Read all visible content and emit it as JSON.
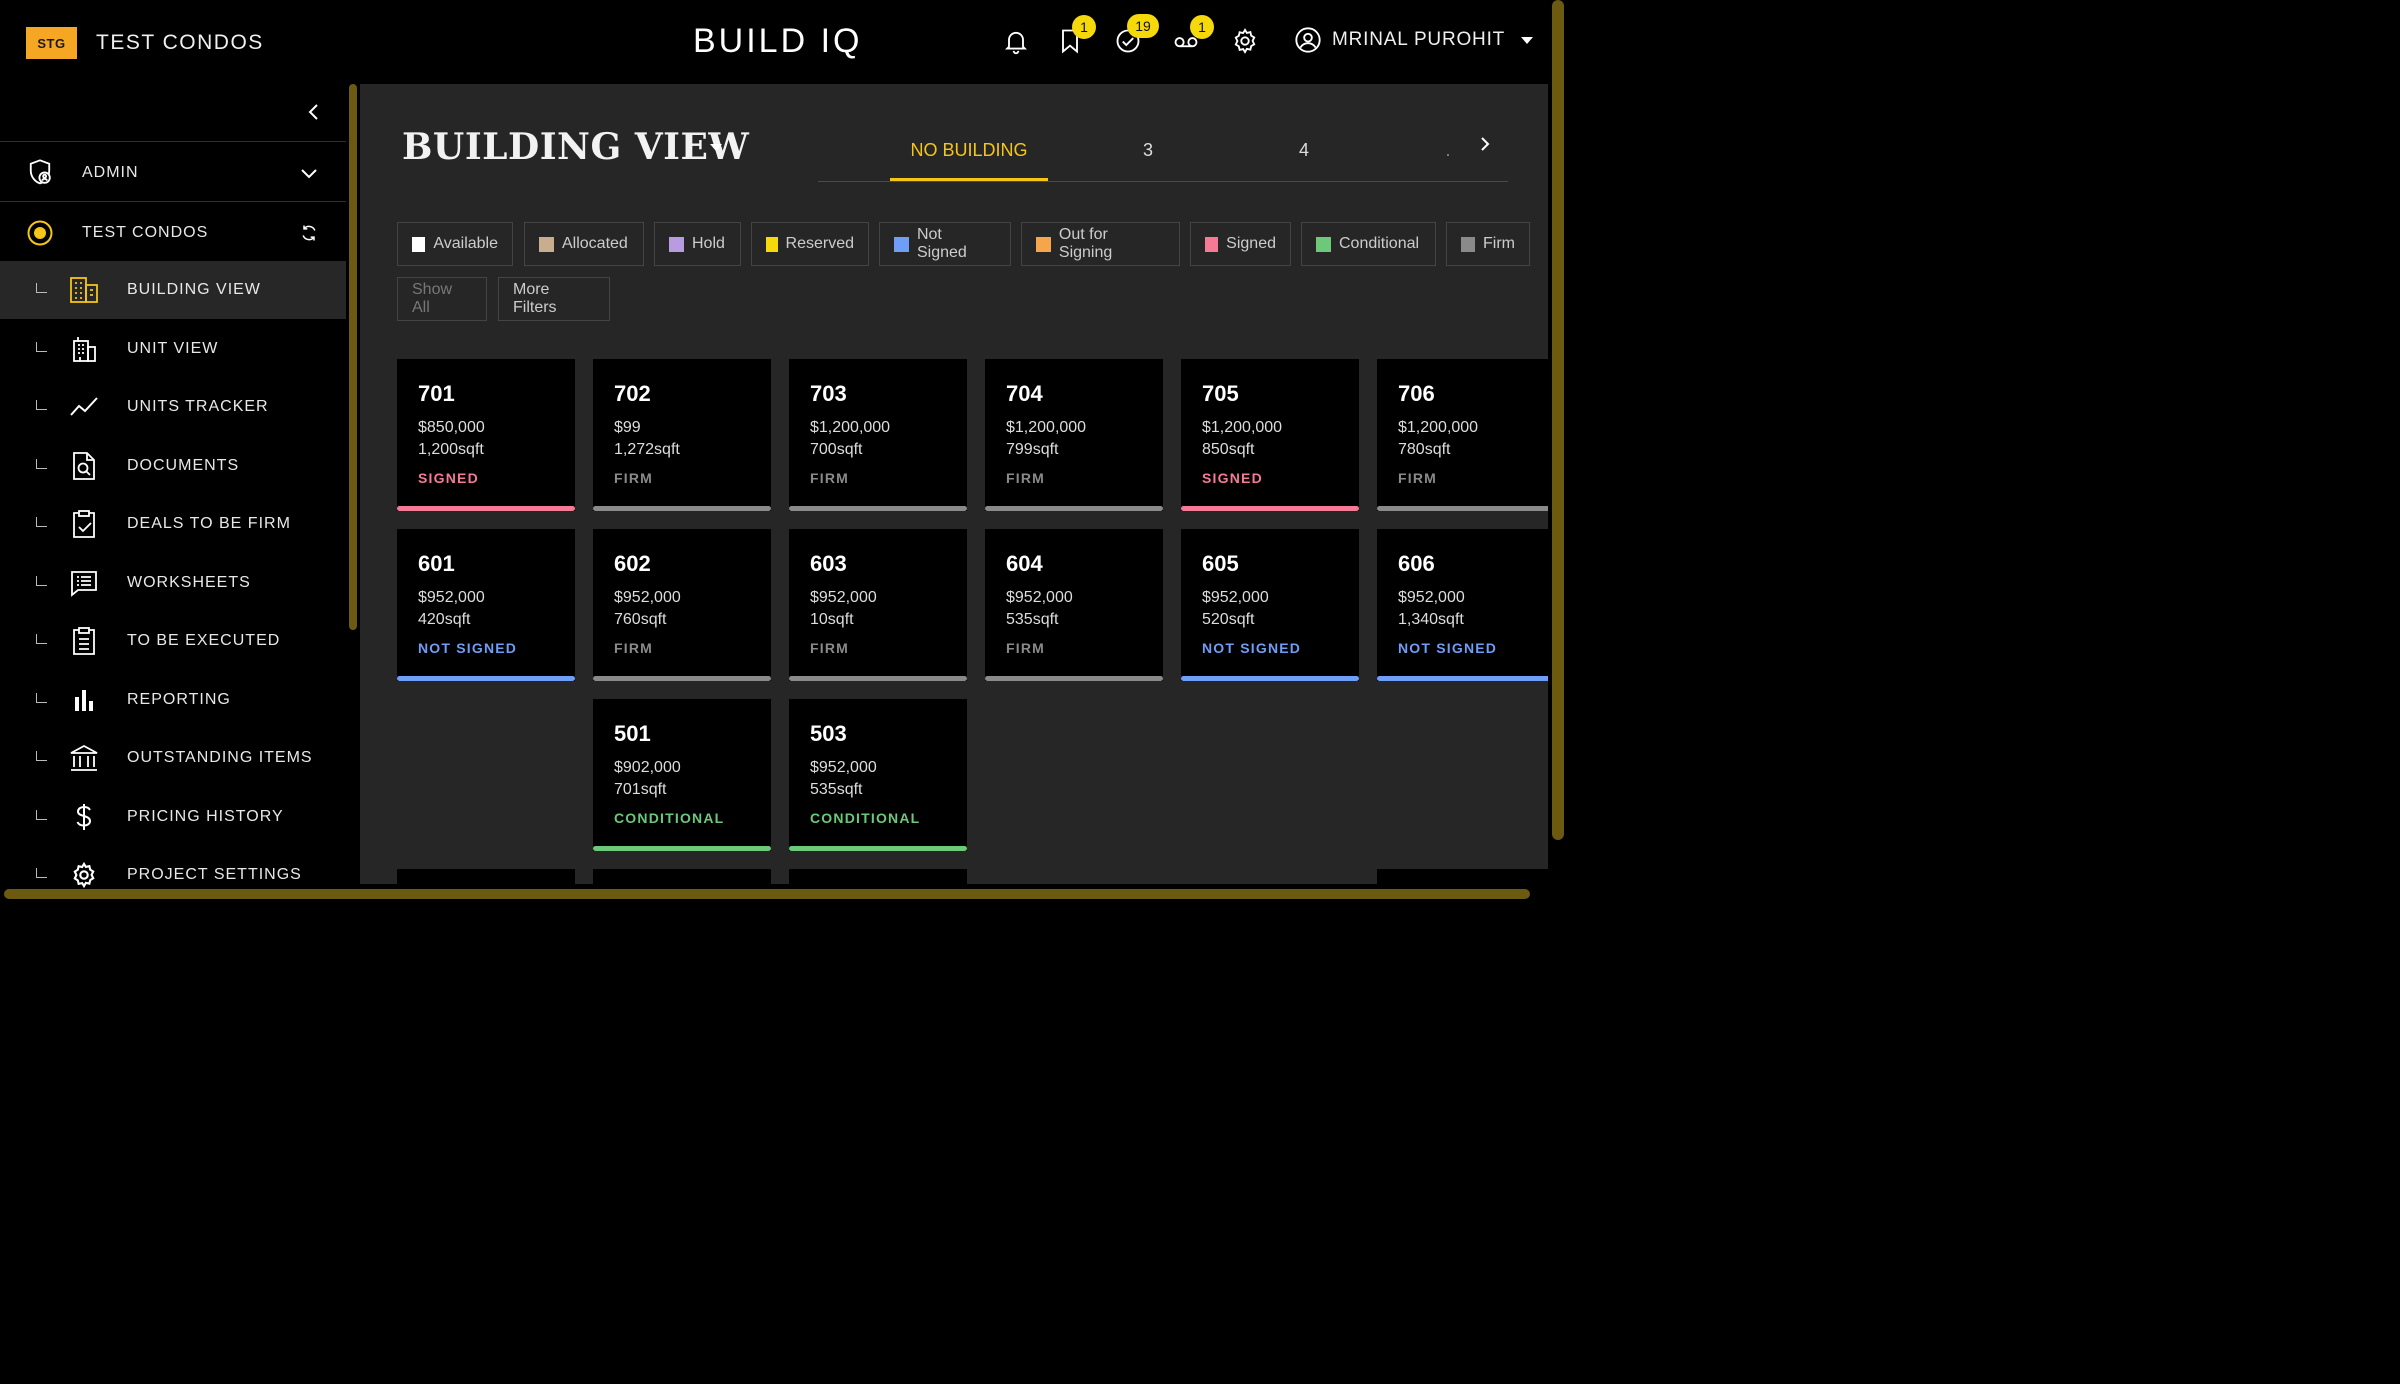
{
  "header": {
    "env_badge": "STG",
    "project_name": "TEST CONDOS",
    "app_title": "BUILD IQ",
    "icons": [
      {
        "name": "bell-icon",
        "badge": null
      },
      {
        "name": "bookmark-icon",
        "badge": "1"
      },
      {
        "name": "check-circle-icon",
        "badge": "19"
      },
      {
        "name": "voicemail-icon",
        "badge": "1"
      },
      {
        "name": "gear-icon",
        "badge": null
      }
    ],
    "user_name": "MRINAL PUROHIT"
  },
  "sidebar": {
    "sections": [
      {
        "label": "ADMIN",
        "icon": "shield-user-icon"
      },
      {
        "label": "TEST CONDOS",
        "icon": "radio-selected-icon"
      }
    ],
    "items": [
      {
        "label": "BUILDING VIEW",
        "icon": "building-icon",
        "active": true
      },
      {
        "label": "UNIT VIEW",
        "icon": "office-building-icon"
      },
      {
        "label": "UNITS TRACKER",
        "icon": "trend-line-icon"
      },
      {
        "label": "DOCUMENTS",
        "icon": "document-search-icon"
      },
      {
        "label": "DEALS TO BE FIRM",
        "icon": "clipboard-check-icon"
      },
      {
        "label": "WORKSHEETS",
        "icon": "worksheet-icon"
      },
      {
        "label": "TO BE EXECUTED",
        "icon": "clipboard-list-icon"
      },
      {
        "label": "REPORTING",
        "icon": "bar-chart-icon"
      },
      {
        "label": "OUTSTANDING ITEMS",
        "icon": "bank-icon"
      },
      {
        "label": "PRICING HISTORY",
        "icon": "dollar-icon"
      },
      {
        "label": "PROJECT SETTINGS",
        "icon": "settings-icon"
      }
    ]
  },
  "main": {
    "title": "BUILDING VIEW",
    "tabs": [
      "NO BUILDING",
      "3",
      "4",
      "."
    ],
    "active_tab": "NO BUILDING",
    "legend": [
      {
        "label": "Available",
        "color": "#ffffff"
      },
      {
        "label": "Allocated",
        "color": "#c9ad8f"
      },
      {
        "label": "Hold",
        "color": "#b89be0"
      },
      {
        "label": "Reserved",
        "color": "#f5d90a"
      },
      {
        "label": "Not Signed",
        "color": "#6e9ef5"
      },
      {
        "label": "Out for Signing",
        "color": "#f5a64a"
      },
      {
        "label": "Signed",
        "color": "#f57a96"
      },
      {
        "label": "Conditional",
        "color": "#6cc97a"
      },
      {
        "label": "Firm",
        "color": "#8a8a8a"
      }
    ],
    "filters": {
      "show_all": "Show All",
      "more_filters": "More Filters"
    },
    "status_colors": {
      "SIGNED": "#f57a96",
      "FIRM": "#8a8a8a",
      "NOT SIGNED": "#6e9ef5",
      "CONDITIONAL": "#6cc97a"
    },
    "floors": [
      [
        {
          "unit": "701",
          "price": "$850,000",
          "sqft": "1,200sqft",
          "status": "SIGNED"
        },
        {
          "unit": "702",
          "price": "$99",
          "sqft": "1,272sqft",
          "status": "FIRM"
        },
        {
          "unit": "703",
          "price": "$1,200,000",
          "sqft": "700sqft",
          "status": "FIRM"
        },
        {
          "unit": "704",
          "price": "$1,200,000",
          "sqft": "799sqft",
          "status": "FIRM"
        },
        {
          "unit": "705",
          "price": "$1,200,000",
          "sqft": "850sqft",
          "status": "SIGNED"
        },
        {
          "unit": "706",
          "price": "$1,200,000",
          "sqft": "780sqft",
          "status": "FIRM"
        }
      ],
      [
        {
          "unit": "601",
          "price": "$952,000",
          "sqft": "420sqft",
          "status": "NOT SIGNED"
        },
        {
          "unit": "602",
          "price": "$952,000",
          "sqft": "760sqft",
          "status": "FIRM"
        },
        {
          "unit": "603",
          "price": "$952,000",
          "sqft": "10sqft",
          "status": "FIRM"
        },
        {
          "unit": "604",
          "price": "$952,000",
          "sqft": "535sqft",
          "status": "FIRM"
        },
        {
          "unit": "605",
          "price": "$952,000",
          "sqft": "520sqft",
          "status": "NOT SIGNED"
        },
        {
          "unit": "606",
          "price": "$952,000",
          "sqft": "1,340sqft",
          "status": "NOT SIGNED"
        }
      ],
      [
        null,
        {
          "unit": "501",
          "price": "$902,000",
          "sqft": "701sqft",
          "status": "CONDITIONAL"
        },
        {
          "unit": "503",
          "price": "$952,000",
          "sqft": "535sqft",
          "status": "CONDITIONAL"
        },
        null,
        null,
        null
      ]
    ]
  }
}
